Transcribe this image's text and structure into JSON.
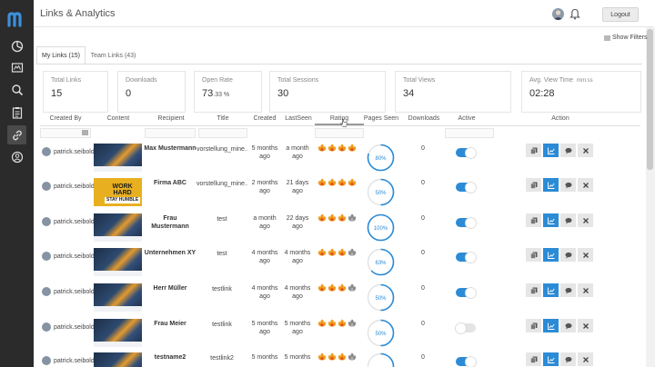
{
  "app": {
    "title": "Links & Analytics",
    "logout_label": "Logout",
    "show_filters_label": "Show Filters"
  },
  "colors": {
    "sidebar_bg": "#2b2b2b",
    "accent": "#2b8bd6",
    "logo": "#3d8fdc"
  },
  "sidebar": {
    "items": [
      {
        "icon": "dashboard-icon"
      },
      {
        "icon": "presentation-icon"
      },
      {
        "icon": "search-icon"
      },
      {
        "icon": "clipboard-icon"
      },
      {
        "icon": "link-icon",
        "active": true
      },
      {
        "icon": "contacts-icon"
      }
    ]
  },
  "tabs": [
    {
      "label": "My Links (15)",
      "active": true
    },
    {
      "label": "Team Links (43)",
      "active": false
    }
  ],
  "stats": [
    {
      "label": "Total Links",
      "value": "15"
    },
    {
      "label": "Downloads",
      "value": "0"
    },
    {
      "label": "Open Rate",
      "value": "73",
      "decimals": ".33 %"
    },
    {
      "label": "Total Sessions",
      "value": "30"
    },
    {
      "label": "Total Views",
      "value": "34"
    },
    {
      "label": "Avg. View Time",
      "unit": "mm:ss",
      "value": "02:28"
    }
  ],
  "table": {
    "columns": [
      "Created By",
      "Content",
      "Recipient",
      "Title",
      "Created",
      "LastSeen",
      "Rating",
      "Pages Seen",
      "Downloads",
      "Active",
      "Action"
    ],
    "rows": [
      {
        "creator": "patrick.seibold",
        "thumb": "city",
        "recipient": "Max Mustermann",
        "title": "vorstellung_mine...",
        "created": "5 months ago",
        "lastseen": "a month ago",
        "rating": 4,
        "pages": 80,
        "pages_label": "80%",
        "downloads": "0",
        "active": true
      },
      {
        "creator": "patrick.seibold",
        "thumb": "work",
        "recipient": "Firma ABC",
        "title": "vorstellung_mine...",
        "created": "2 months ago",
        "lastseen": "21 days ago",
        "rating": 4,
        "pages": 50,
        "pages_label": "50%",
        "downloads": "0",
        "active": true
      },
      {
        "creator": "patrick.seibold",
        "thumb": "city",
        "recipient": "Frau Mustermann",
        "title": "test",
        "created": "a month ago",
        "lastseen": "22 days ago",
        "rating": 3,
        "pages": 100,
        "pages_label": "100%",
        "downloads": "0",
        "active": true
      },
      {
        "creator": "patrick.seibold",
        "thumb": "city",
        "recipient": "Unternehmen XY",
        "title": "test",
        "created": "4 months ago",
        "lastseen": "4 months ago",
        "rating": 3,
        "pages": 63,
        "pages_label": "63%",
        "downloads": "0",
        "active": true
      },
      {
        "creator": "patrick.seibold",
        "thumb": "city",
        "recipient": "Herr Müller",
        "title": "testlink",
        "created": "4 months ago",
        "lastseen": "4 months ago",
        "rating": 3,
        "pages": 50,
        "pages_label": "50%",
        "downloads": "0",
        "active": true
      },
      {
        "creator": "patrick.seibold",
        "thumb": "city",
        "recipient": "Frau Meier",
        "title": "testlink",
        "created": "5 months ago",
        "lastseen": "5 months ago",
        "rating": 3,
        "pages": 50,
        "pages_label": "50%",
        "downloads": "0",
        "active": false
      },
      {
        "creator": "patrick.seibold",
        "thumb": "city",
        "recipient": "testname2",
        "title": "testlink2",
        "created": "5 months",
        "lastseen": "5 months",
        "rating": 3,
        "pages": 50,
        "pages_label": "",
        "downloads": "0",
        "active": true
      }
    ]
  },
  "thumb_text": {
    "line1": "WORK",
    "line2": "HARD",
    "line3": "STAY HUMBLE"
  },
  "actions": [
    "copy-icon",
    "chart-icon",
    "comment-icon",
    "delete-icon"
  ]
}
